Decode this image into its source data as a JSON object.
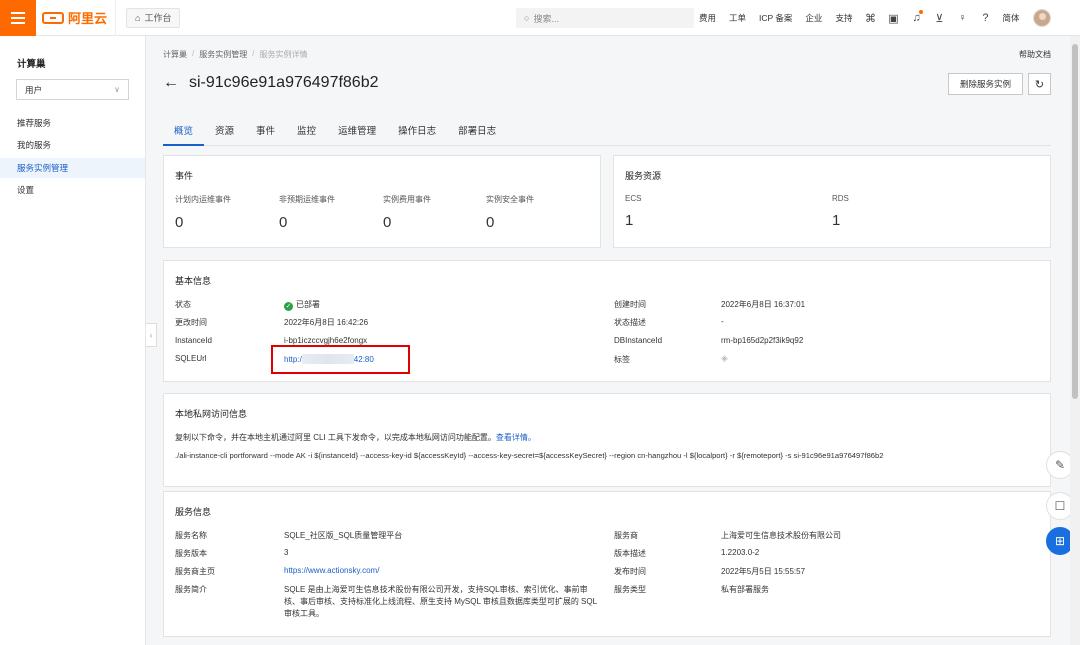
{
  "topbar": {
    "logo": "阿里云",
    "workbench": "工作台",
    "search_placeholder": "搜索...",
    "nav": [
      "费用",
      "工单",
      "ICP 备案",
      "企业",
      "支持"
    ],
    "lang": "简体"
  },
  "sidebar": {
    "title": "计算巢",
    "select_value": "用户",
    "items": [
      {
        "label": "推荐服务"
      },
      {
        "label": "我的服务"
      },
      {
        "label": "服务实例管理"
      },
      {
        "label": "设置"
      }
    ]
  },
  "breadcrumb": [
    "计算巢",
    "服务实例管理",
    "服务实例详情"
  ],
  "help": "帮助文档",
  "page_title": "si-91c96e91a976497f86b2",
  "delete_button": "删除服务实例",
  "tabs": [
    "概览",
    "资源",
    "事件",
    "监控",
    "运维管理",
    "操作日志",
    "部署日志"
  ],
  "events": {
    "title": "事件",
    "stats": [
      {
        "label": "计划内运维事件",
        "value": "0"
      },
      {
        "label": "非预期运维事件",
        "value": "0"
      },
      {
        "label": "实例费用事件",
        "value": "0"
      },
      {
        "label": "实例安全事件",
        "value": "0"
      }
    ]
  },
  "resources": {
    "title": "服务资源",
    "stats": [
      {
        "label": "ECS",
        "value": "1"
      },
      {
        "label": "RDS",
        "value": "1"
      }
    ]
  },
  "basic": {
    "title": "基本信息",
    "status_label": "状态",
    "status_value": "已部署",
    "updated_label": "更改时间",
    "updated_value": "2022年6月8日 16:42:26",
    "instance_label": "InstanceId",
    "instance_value": "i-bp1iczccvgjh6e2fongx",
    "sqle_label": "SQLEUrl",
    "sqle_prefix": "http:/",
    "sqle_suffix": "42:80",
    "created_label": "创建时间",
    "created_value": "2022年6月8日 16:37:01",
    "statedesc_label": "状态描述",
    "statedesc_value": "-",
    "db_label": "DBInstanceId",
    "db_value": "rm-bp165d2p2f3ik9q92",
    "tag_label": "标签"
  },
  "private_net": {
    "title": "本地私网访问信息",
    "desc": "复制以下命令，并在本地主机通过阿里 CLI 工具下发命令，以完成本地私网访问功能配置。",
    "desc_link": "查看详情。",
    "command": "./ali-instance-cli portforward --mode AK -i ${instanceId} --access-key-id ${accessKeyId} --access-key-secret=${accessKeySecret} --region cn-hangzhou -l ${localport} -r ${remoteport} -s si-91c96e91a976497f86b2"
  },
  "service": {
    "title": "服务信息",
    "name_label": "服务名称",
    "name_value": "SQLE_社区版_SQL质量管理平台",
    "version_label": "服务版本",
    "version_value": "3",
    "homepage_label": "服务商主页",
    "homepage_value": "https://www.actionsky.com/",
    "intro_label": "服务简介",
    "intro_value": "SQLE 是由上海爱可生信息技术股份有限公司开发，支持SQL审核、索引优化、事前审核、事后审核、支持标准化上线流程、原生支持 MySQL 审核且数据库类型可扩展的 SQL 审核工具。",
    "provider_label": "服务商",
    "provider_value": "上海爱可生信息技术股份有限公司",
    "vdesc_label": "版本描述",
    "vdesc_value": "1.2203.0-2",
    "publish_label": "发布时间",
    "publish_value": "2022年5月5日 15:55:57",
    "type_label": "服务类型",
    "type_value": "私有部署服务"
  },
  "colors": {
    "brand": "#ff6a00",
    "link": "#1a5fc9",
    "success": "#2aa244",
    "highlight": "#e00000"
  }
}
